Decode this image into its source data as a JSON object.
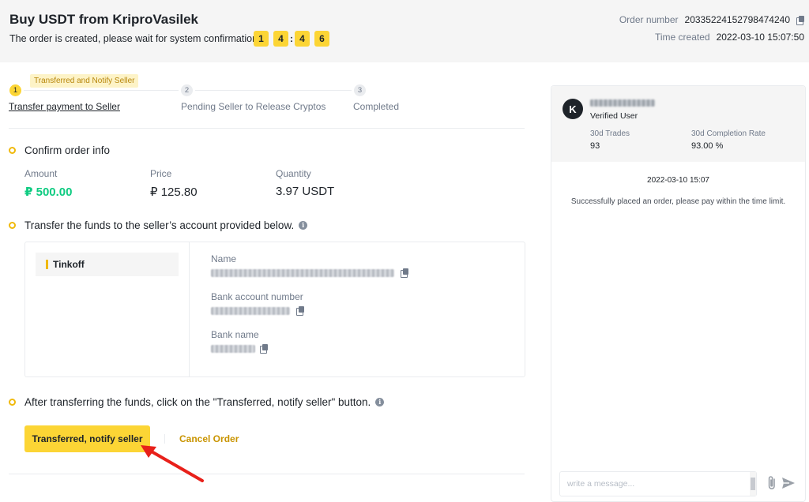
{
  "header": {
    "title": "Buy USDT from KriproVasilek",
    "subtitle": "The order is created, please wait for system confirmation.",
    "timer": [
      "1",
      "4",
      "4",
      "6"
    ],
    "timer_sep": ":",
    "order_number_label": "Order number",
    "order_number": "20335224152798474240",
    "time_created_label": "Time created",
    "time_created": "2022-03-10 15:07:50"
  },
  "stepper": {
    "tag": "Transferred and Notify Seller",
    "steps": [
      {
        "num": "1",
        "label": "Transfer payment to Seller",
        "active": true
      },
      {
        "num": "2",
        "label": "Pending Seller to Release Cryptos",
        "active": false
      },
      {
        "num": "3",
        "label": "Completed",
        "active": false
      }
    ]
  },
  "confirm": {
    "title": "Confirm order info",
    "amount_label": "Amount",
    "amount": "₽ 500.00",
    "price_label": "Price",
    "price": "₽ 125.80",
    "quantity_label": "Quantity",
    "quantity": "3.97 USDT"
  },
  "transfer": {
    "title": "Transfer the funds to the seller’s account provided below.",
    "method": "Tinkoff",
    "name_label": "Name",
    "account_label": "Bank account number",
    "bank_label": "Bank name"
  },
  "notify": {
    "title": "After transferring the funds, click on the \"Transferred, notify seller\" button.",
    "primary_button": "Transferred, notify seller",
    "cancel_button": "Cancel Order"
  },
  "chat": {
    "avatar_letter": "K",
    "verified": "Verified User",
    "trades_label": "30d Trades",
    "trades": "93",
    "completion_label": "30d Completion Rate",
    "completion": "93.00 %",
    "timestamp": "2022-03-10 15:07",
    "system_message": "Successfully placed an order, please pay within the time limit.",
    "input_placeholder": "write a message..."
  },
  "colors": {
    "accent": "#fcd535",
    "positive": "#0ecb81",
    "link": "#c99400",
    "annotation_arrow": "#e8201a"
  }
}
